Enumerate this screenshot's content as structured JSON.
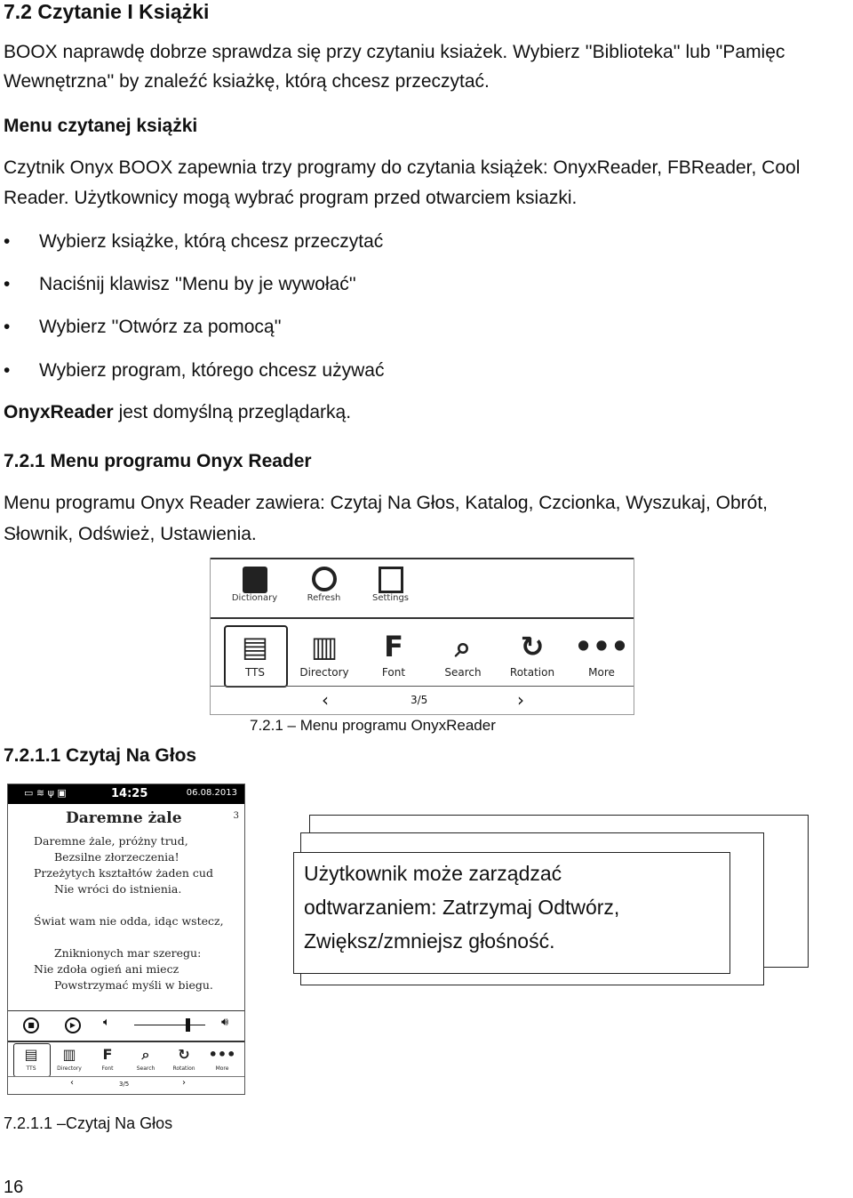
{
  "heading": "7.2 Czytanie I Książki",
  "intro": [
    "BOOX naprawdę dobrze sprawdza się przy czytaniu ksiażek. Wybierz ''Biblioteka'' lub ''Pamięc",
    "Wewnętrzna'' by znaleźć ksiażkę, którą chcesz przeczytać."
  ],
  "subheading": "Menu czytanej książki",
  "para": [
    "Czytnik Onyx BOOX zapewnia trzy programy do czytania książek: OnyxReader, FBReader, Cool",
    "Reader. Użytkownicy mogą wybrać program przed otwarciem ksiazki."
  ],
  "bullets": [
    "Wybierz książke, którą chcesz przeczytać",
    "Naciśnij klawisz ''Menu by je wywołać''",
    "Wybierz ''Otwórz za pomocą''",
    "Wybierz program, którego chcesz używać"
  ],
  "default_bold": "OnyxReader",
  "default_rest": " jest domyślną przeglądarką.",
  "section": "7.2.1 Menu programu Onyx Reader",
  "section_para": [
    "Menu programu Onyx Reader zawiera:  Czytaj Na Głos, Katalog, Czcionka, Wyszukaj, Obrót,",
    "Słownik, Odśwież, Ustawienia."
  ],
  "menu": {
    "top": [
      "Dictionary",
      "Refresh",
      "Settings"
    ],
    "bottom": [
      "TTS",
      "Directory",
      "Font",
      "Search",
      "Rotation",
      "More"
    ],
    "page": "3/5",
    "prev": "‹",
    "next": "›"
  },
  "menu_caption": "7.2.1 – Menu programu OnyxReader",
  "subsection": "7.2.1.1 Czytaj Na Głos",
  "device": {
    "time": "14:25",
    "date": "06.08.2013",
    "title": "Daremne żale",
    "page_num": "3",
    "poem": [
      "Daremne żale, próżny trud,",
      "Bezsilne złorzeczenia!",
      "Przeżytych kształtów żaden cud",
      "Nie wróci do istnienia.",
      "Świat wam nie odda, idąc wstecz,",
      "Zniknionych mar szeregu:",
      "Nie zdoła ogień ani miecz",
      "Powstrzymać myśli w biegu."
    ],
    "volume_percent": 75,
    "toolbar": [
      "TTS",
      "Directory",
      "Font",
      "Search",
      "Rotation",
      "More"
    ],
    "page": "3/5"
  },
  "note": [
    "Użytkownik może zarządzać",
    "odtwarzaniem: Zatrzymaj Odtwórz,",
    "Zwiększ/zmniejsz głośność."
  ],
  "device_caption": "7.2.1.1 –Czytaj Na Głos",
  "page_number": "16"
}
